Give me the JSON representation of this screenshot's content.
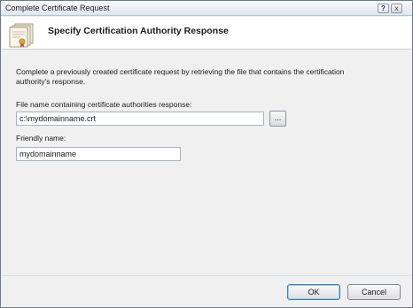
{
  "window": {
    "title": "Complete Certificate Request",
    "help_glyph": "?",
    "close_glyph": "x"
  },
  "header": {
    "heading": "Specify Certification Authority Response",
    "icon": "certificate-icon"
  },
  "form": {
    "description": "Complete a previously created certificate request by retrieving the file that contains the certification authority's response.",
    "file_label": "File name containing certificate authorities response:",
    "file_value": "c:\\mydomainname.crt",
    "browse_label": "...",
    "friendly_label": "Friendly name:",
    "friendly_value": "mydomainname"
  },
  "footer": {
    "ok_label": "OK",
    "cancel_label": "Cancel"
  },
  "colors": {
    "title_bar": "#dfe6ef",
    "dialog_bg": "#f0f0f0",
    "default_button_border": "#3c7fb1"
  }
}
